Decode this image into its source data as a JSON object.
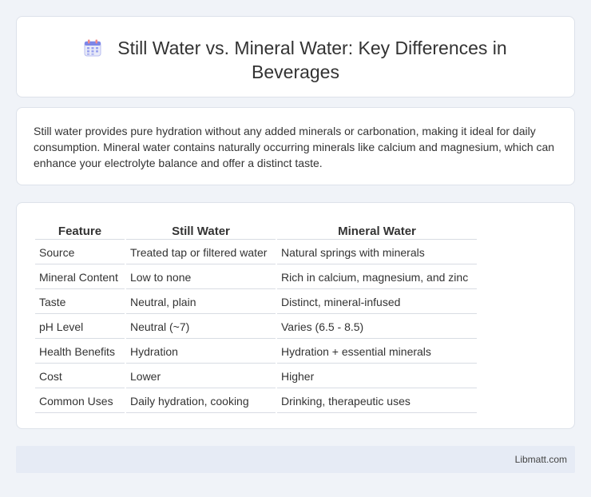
{
  "header": {
    "icon": "calendar-icon",
    "title": "Still Water vs. Mineral Water: Key Differences in Beverages"
  },
  "intro": {
    "text": "Still water provides pure hydration without any added minerals or carbonation, making it ideal for daily consumption. Mineral water contains naturally occurring minerals like calcium and magnesium, which can enhance your electrolyte balance and offer a distinct taste."
  },
  "table": {
    "headers": [
      "Feature",
      "Still Water",
      "Mineral Water"
    ],
    "rows": [
      [
        "Source",
        "Treated tap or filtered water",
        "Natural springs with minerals"
      ],
      [
        "Mineral Content",
        "Low to none",
        "Rich in calcium, magnesium, and zinc"
      ],
      [
        "Taste",
        "Neutral, plain",
        "Distinct, mineral-infused"
      ],
      [
        "pH Level",
        "Neutral (~7)",
        "Varies (6.5 - 8.5)"
      ],
      [
        "Health Benefits",
        "Hydration",
        "Hydration + essential minerals"
      ],
      [
        "Cost",
        "Lower",
        "Higher"
      ],
      [
        "Common Uses",
        "Daily hydration, cooking",
        "Drinking, therapeutic uses"
      ]
    ]
  },
  "footer": {
    "site": "Libmatt.com"
  },
  "colors": {
    "background": "#f0f3f8",
    "footer_bg": "#e6ebf5",
    "icon_accent": "#8e8ee6"
  }
}
